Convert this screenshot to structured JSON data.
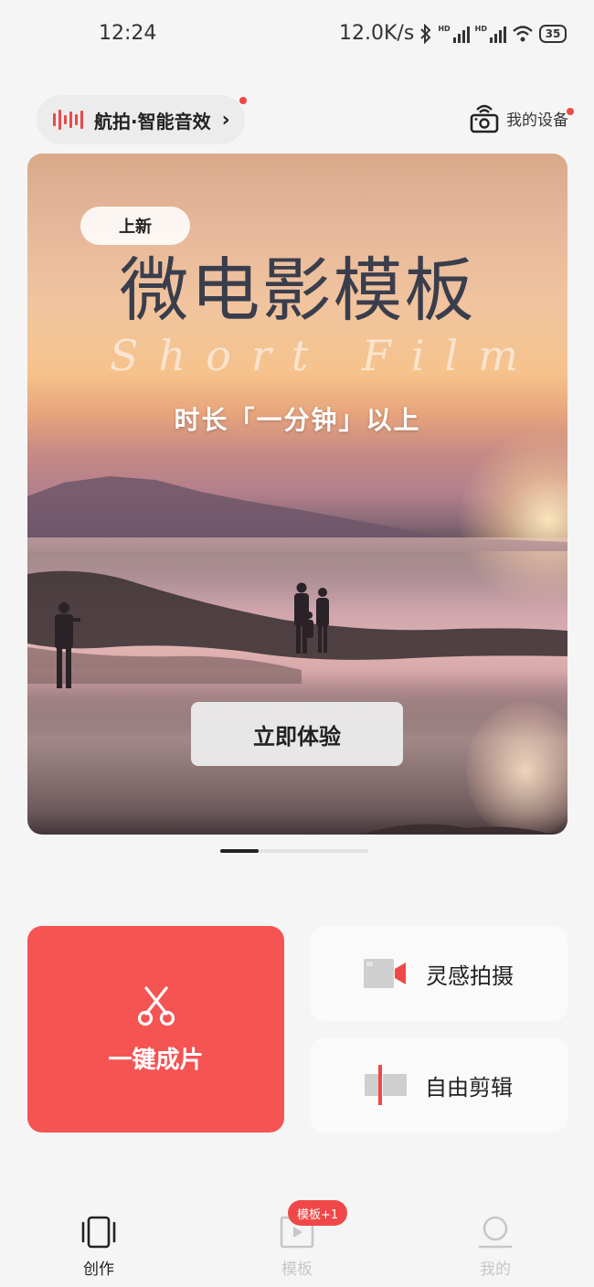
{
  "status_bar": {
    "time": "12:24",
    "network_speed": "12.0K/s",
    "network_tag_1": "HD",
    "network_tag_2": "HD",
    "battery": "35"
  },
  "top": {
    "sound_effect_label": "航拍·智能音效",
    "device_label": "我的设备"
  },
  "banner": {
    "badge": "上新",
    "title": "微电影模板",
    "script_text": "Short Film",
    "subtitle": "时长「一分钟」以上",
    "cta_label": "立即体验",
    "page_count": 2,
    "current_page": 1
  },
  "actions": {
    "quick_create_label": "一键成片",
    "inspiration_shoot_label": "灵感拍摄",
    "free_edit_label": "自由剪辑"
  },
  "tabs": {
    "create": "创作",
    "template": "模板",
    "template_badge": "模板+1",
    "mine": "我的"
  },
  "colors": {
    "accent": "#f65353",
    "badge_red": "#f04848"
  }
}
